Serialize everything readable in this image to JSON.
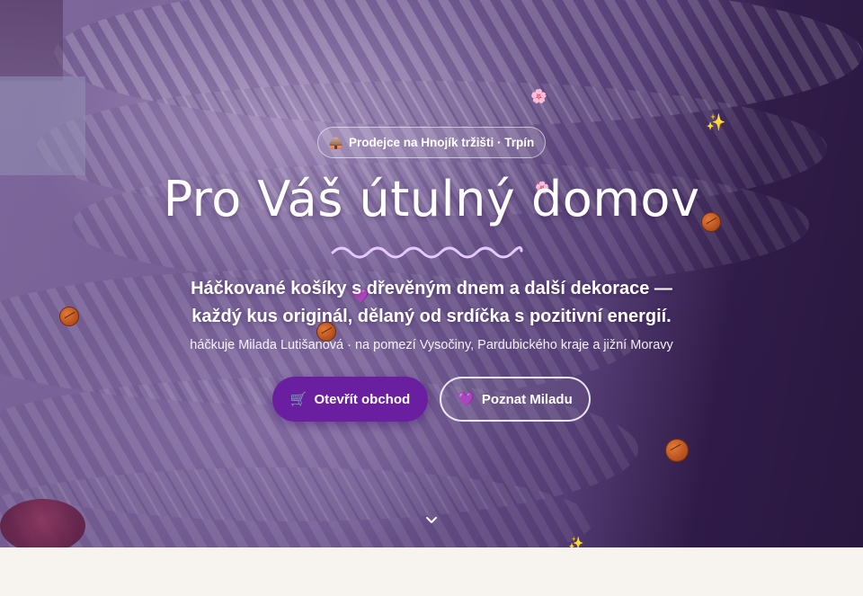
{
  "hero": {
    "badge_icon": "market-stall-icon",
    "badge_text": "Prodejce na Hnojík tržišti · Trpín",
    "title": "Pro Váš útulný domov",
    "lead_line1": "Háčkované košíky s dřevěným dnem a další dekorace —",
    "lead_line2": "každý kus originál, dělaný od srdíčka s pozitivní energií.",
    "subtitle": "háčkuje Milada Lutišanová · na pomezí Vysočiny, Pardubického kraje a jižní Moravy",
    "btn_shop": {
      "icon": "🛒",
      "label": "Otevřít obchod"
    },
    "btn_meet": {
      "icon": "💜",
      "label": "Poznat Miladu"
    },
    "scroll_icon": "chevron-down-icon"
  },
  "decorations": [
    "cherry-blossom-icon",
    "sparkles-icon",
    "yarn-ball-icon",
    "purple-heart-icon"
  ],
  "colors": {
    "primary_button": "#6a1fa0",
    "wave": "#e4c8ff",
    "page_background": "#f7f3ee"
  }
}
